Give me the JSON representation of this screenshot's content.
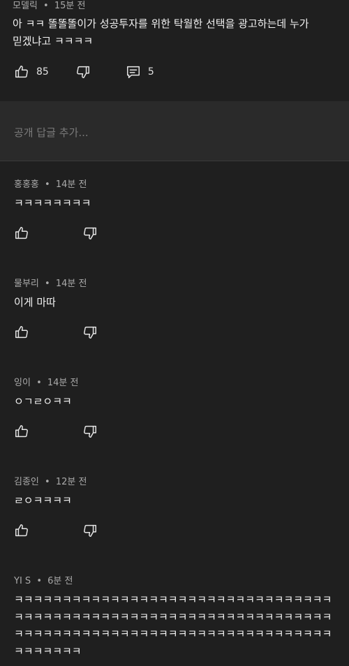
{
  "parent": {
    "author": "모델릭",
    "time": "15분 전",
    "text": "아 ㅋㅋ 똘똘똘이가 성공투자를 위한 탁월한 선택을 광고하는데 누가 믿겠냐고 ㅋㅋㅋㅋ",
    "likes": "85",
    "replies": "5"
  },
  "reply_input": {
    "placeholder": "공개 답글 추가..."
  },
  "replies": [
    {
      "author": "홍홍홍",
      "time": "14분 전",
      "text": "ㅋㅋㅋㅋㅋㅋㅋㅋ"
    },
    {
      "author": "물부리",
      "time": "14분 전",
      "text": "이게 마따"
    },
    {
      "author": "잉이",
      "time": "14분 전",
      "text": "ㅇㄱㄹㅇㅋㅋ"
    },
    {
      "author": "김종인",
      "time": "12분 전",
      "text": "ㄹㅇㅋㅋㅋㅋ"
    },
    {
      "author": "YI S",
      "time": "6분 전",
      "text_lines": [
        "ㅋㅋㅋㅋㅋㅋㅋㅋㅋㅋㅋㅋㅋㅋㅋㅋㅋㅋㅋㅋㅋㅋㅋㅋㅋㅋㅋㅋㅋㅋㅋㅋㅋ",
        "ㅋㅋㅋㅋㅋㅋㅋㅋㅋㅋㅋㅋㅋㅋㅋㅋㅋㅋㅋㅋㅋㅋㅋㅋㅋㅋㅋㅋㅋㅋㅋㅋㅋ",
        "ㅋㅋㅋㅋㅋㅋㅋㅋㅋㅋㅋㅋㅋㅋㅋㅋㅋㅋㅋㅋㅋㅋㅋㅋㅋㅋㅋㅋㅋㅋㅋㅋㅋ",
        "ㅋㅋㅋㅋㅋㅋㅋ"
      ]
    }
  ],
  "separator": "•",
  "icons": {
    "like": "thumbs-up-icon",
    "dislike": "thumbs-down-icon",
    "reply": "comment-icon"
  },
  "colors": {
    "background": "#1f1f1f",
    "input_background": "#2a2a2a",
    "meta_text": "#aaaaaa",
    "body_text": "#f1f1f1"
  }
}
